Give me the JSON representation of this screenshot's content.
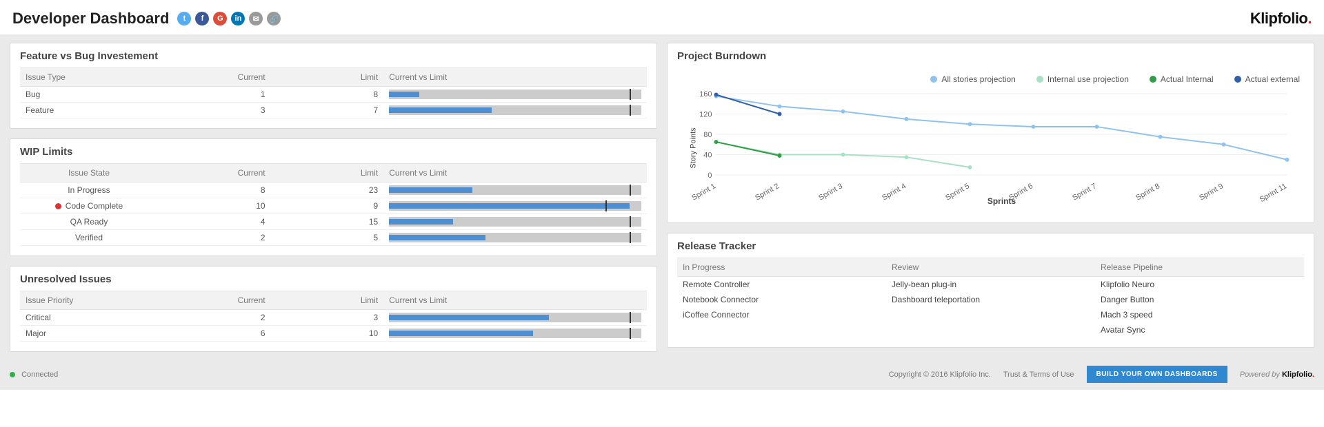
{
  "page_title": "Developer Dashboard",
  "brand": "Klipfolio",
  "share": {
    "twitter": "twitter-icon",
    "facebook": "facebook-icon",
    "google": "google-plus-icon",
    "linkedin": "linkedin-icon",
    "email": "email-icon",
    "link": "link-icon"
  },
  "panels": {
    "fvb": {
      "title": "Feature vs Bug Investement",
      "headers": {
        "issue": "Issue Type",
        "current": "Current",
        "limit": "Limit",
        "cvl": "Current vs Limit"
      },
      "rows": [
        {
          "label": "Bug",
          "current": 1,
          "limit": 8
        },
        {
          "label": "Feature",
          "current": 3,
          "limit": 7
        }
      ]
    },
    "wip": {
      "title": "WIP Limits",
      "headers": {
        "issue": "Issue State",
        "current": "Current",
        "limit": "Limit",
        "cvl": "Current vs Limit"
      },
      "rows": [
        {
          "label": "In Progress",
          "current": 8,
          "limit": 23,
          "status": null
        },
        {
          "label": "Code Complete",
          "current": 10,
          "limit": 9,
          "status": "red"
        },
        {
          "label": "QA Ready",
          "current": 4,
          "limit": 15,
          "status": null
        },
        {
          "label": "Verified",
          "current": 2,
          "limit": 5,
          "status": null
        }
      ]
    },
    "unres": {
      "title": "Unresolved Issues",
      "headers": {
        "issue": "Issue Priority",
        "current": "Current",
        "limit": "Limit",
        "cvl": "Current vs Limit"
      },
      "rows": [
        {
          "label": "Critical",
          "current": 2,
          "limit": 3
        },
        {
          "label": "Major",
          "current": 6,
          "limit": 10
        }
      ]
    },
    "burndown": {
      "title": "Project Burndown",
      "legend": {
        "proj": "All stories projection",
        "intp": "Internal use projection",
        "ai": "Actual Internal",
        "ae": "Actual external"
      },
      "xlabel": "Sprints",
      "ylabel": "Story Points"
    },
    "release": {
      "title": "Release Tracker",
      "headers": {
        "inprog": "In Progress",
        "review": "Review",
        "pipeline": "Release Pipeline"
      },
      "columns": {
        "inprog": [
          "Remote Controller",
          "Notebook Connector",
          "iCoffee Connector"
        ],
        "review": [
          "Jelly-bean plug-in",
          "Dashboard teleportation"
        ],
        "pipeline": [
          "Klipfolio Neuro",
          "Danger Button",
          "Mach 3 speed",
          "Avatar Sync"
        ]
      }
    }
  },
  "chart_data": {
    "type": "line",
    "title": "Project Burndown",
    "xlabel": "Sprints",
    "ylabel": "Story Points",
    "ylim": [
      0,
      160
    ],
    "categories": [
      "Sprint 1",
      "Sprint 2",
      "Sprint 3",
      "Sprint 4",
      "Sprint 5",
      "Sprint 6",
      "Sprint 7",
      "Sprint 8",
      "Sprint 9",
      "Sprint 11"
    ],
    "series": [
      {
        "name": "All stories projection",
        "values": [
          155,
          135,
          125,
          110,
          100,
          95,
          95,
          75,
          60,
          30
        ]
      },
      {
        "name": "Internal use projection",
        "values": [
          65,
          40,
          40,
          35,
          15,
          null,
          null,
          null,
          null,
          null
        ]
      },
      {
        "name": "Actual Internal",
        "values": [
          65,
          38,
          null,
          null,
          null,
          null,
          null,
          null,
          null,
          null
        ]
      },
      {
        "name": "Actual external",
        "values": [
          158,
          120,
          null,
          null,
          null,
          null,
          null,
          null,
          null,
          null
        ]
      }
    ]
  },
  "footer": {
    "connected": "Connected",
    "copyright": "Copyright © 2016 Klipfolio Inc.",
    "trust": "Trust & Terms of Use",
    "cta": "BUILD YOUR OWN DASHBOARDS",
    "powered": "Powered by"
  }
}
